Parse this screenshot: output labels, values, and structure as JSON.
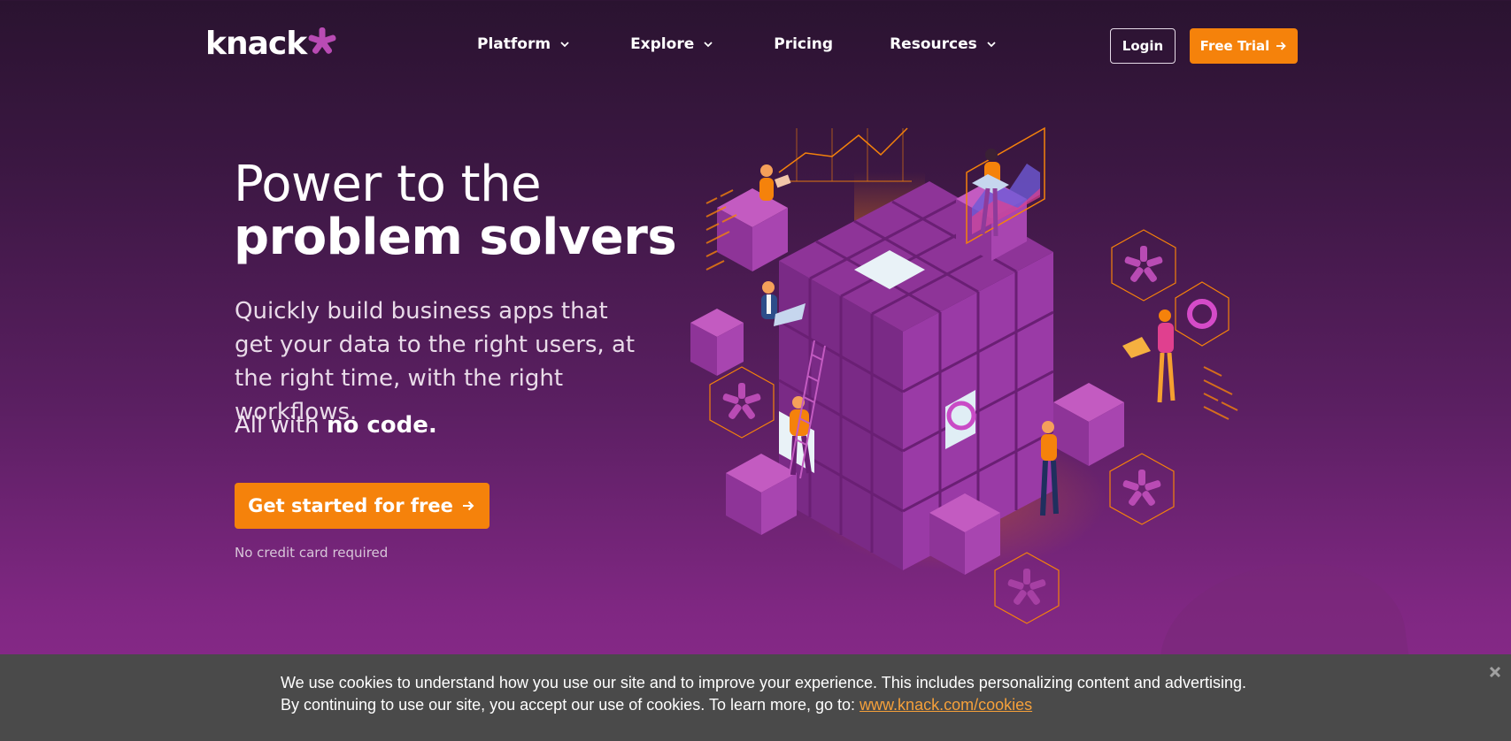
{
  "brand": {
    "name": "knack",
    "accent": "#f5820b",
    "star_color": "#b94bb4"
  },
  "nav": {
    "items": [
      {
        "label": "Platform",
        "has_dropdown": true
      },
      {
        "label": "Explore",
        "has_dropdown": true
      },
      {
        "label": "Pricing",
        "has_dropdown": false
      },
      {
        "label": "Resources",
        "has_dropdown": true
      }
    ],
    "login_label": "Login",
    "trial_label": "Free Trial"
  },
  "hero": {
    "title_line1": "Power to the",
    "title_line2": "problem solvers",
    "subtitle": "Quickly build business apps that get your data to the right users, at the right time, with the right workflows.",
    "nocode_prefix": "All with ",
    "nocode_bold": "no code.",
    "cta_label": "Get started for free",
    "note": "No credit card required"
  },
  "cookie_banner": {
    "line1": "We use cookies to understand how you use our site and to improve your experience. This includes personalizing content and advertising.",
    "line2_prefix": "By continuing to use our site, you accept our use of cookies. To learn more, go to: ",
    "link_text": "www.knack.com/cookies",
    "close_icon": "close-icon"
  }
}
